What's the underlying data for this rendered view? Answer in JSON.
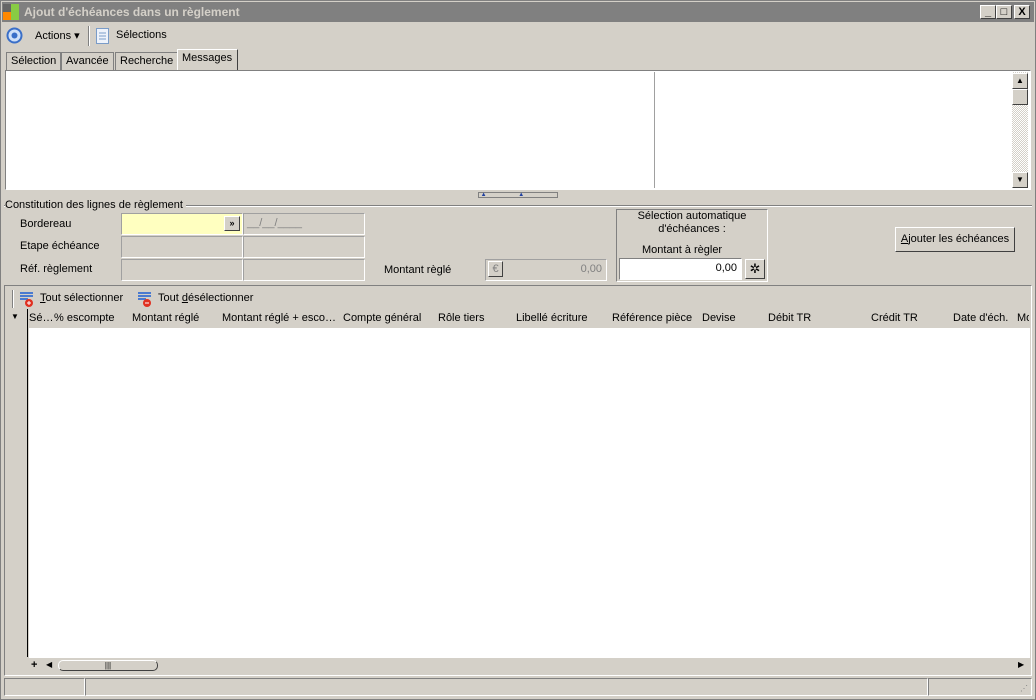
{
  "window": {
    "title": "Ajout d'échéances dans un règlement",
    "minimize": "_",
    "maximize": "□",
    "close": "X"
  },
  "toolbar": {
    "actions": "Actions",
    "selections": "Sélections"
  },
  "tabs": [
    {
      "label": "Sélection"
    },
    {
      "label": "Avancée"
    },
    {
      "label": "Recherche"
    },
    {
      "label": "Messages",
      "active": true
    }
  ],
  "form": {
    "group_title": "Constitution des lignes de règlement",
    "bordereau_label": "Bordereau",
    "bordereau_date": "__/__/____",
    "etape_label": "Etape échéance",
    "ref_label": "Réf. règlement",
    "montant_regle_label": "Montant règlé",
    "montant_regle_value": "0,00",
    "auto_title_1": "Sélection automatique",
    "auto_title_2": "d'échéances :",
    "montant_a_regler_label": "Montant à règler",
    "montant_a_regler_value": "0,00",
    "ajouter_first": "A",
    "ajouter_rest": "jouter les échéances"
  },
  "grid": {
    "select_all_first": "T",
    "select_all_rest": "out sélectionner",
    "deselect_all_pre": "Tout ",
    "deselect_all_u": "d",
    "deselect_all_rest": "ésélectionner",
    "columns": [
      "Sé…",
      "% escompte",
      "Montant réglé",
      "Montant réglé + esco…",
      "Compte général",
      "Rôle tiers",
      "Libellé écriture",
      "Référence pièce",
      "Devise",
      "Débit TR",
      "Crédit TR",
      "Date d'éch.",
      "Mo"
    ],
    "add_row": "+"
  }
}
